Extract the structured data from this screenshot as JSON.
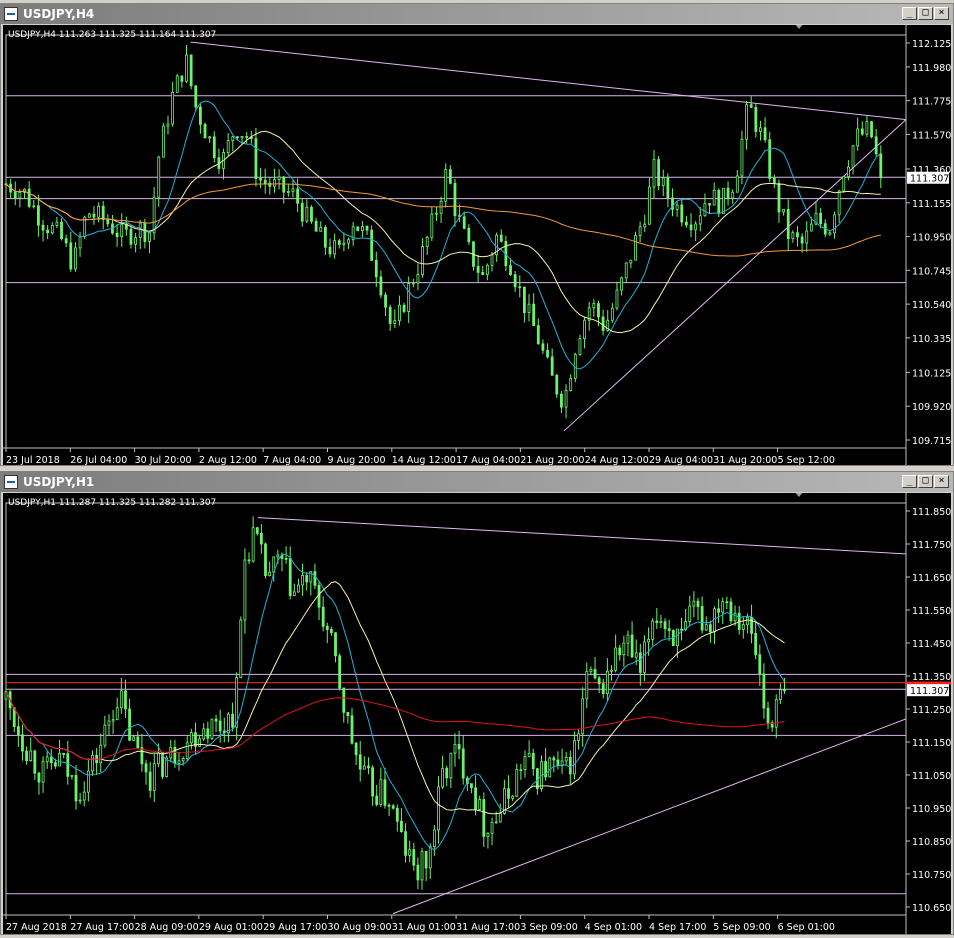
{
  "windows": [
    {
      "title": "USDJPY,H4",
      "info": "USDJPY,H4  111.263 111.325 111.164 111.307",
      "current_price": "111.307",
      "chart_data": {
        "type": "candlestick",
        "symbol": "USDJPY",
        "timeframe": "H4",
        "ylim": [
          109.715,
          112.125
        ],
        "y_ticks": [
          "112.125",
          "111.980",
          "111.775",
          "111.570",
          "111.360",
          "111.155",
          "110.950",
          "110.745",
          "110.540",
          "110.335",
          "110.125",
          "109.920",
          "109.715"
        ],
        "x_ticks": [
          "23 Jul 2018",
          "26 Jul 04:00",
          "30 Jul 20:00",
          "2 Aug 12:00",
          "7 Aug 04:00",
          "9 Aug 20:00",
          "14 Aug 12:00",
          "17 Aug 04:00",
          "21 Aug 20:00",
          "24 Aug 12:00",
          "29 Aug 04:00",
          "31 Aug 20:00",
          "5 Sep 12:00"
        ],
        "last_price": 111.307,
        "horizontal_lines": [
          111.805,
          111.31,
          111.18,
          110.67
        ],
        "trendlines": [
          {
            "from": [
              0.205,
              112.13
            ],
            "to": [
              1.0,
              111.66
            ]
          },
          {
            "from": [
              0.62,
              109.77
            ],
            "to": [
              1.0,
              111.66
            ]
          }
        ],
        "price_path": [
          [
            0.0,
            111.27
          ],
          [
            0.02,
            111.22
          ],
          [
            0.04,
            111.05
          ],
          [
            0.06,
            110.95
          ],
          [
            0.075,
            110.78
          ],
          [
            0.09,
            111.1
          ],
          [
            0.11,
            111.05
          ],
          [
            0.13,
            110.95
          ],
          [
            0.15,
            111.0
          ],
          [
            0.16,
            110.98
          ],
          [
            0.17,
            111.45
          ],
          [
            0.185,
            111.8
          ],
          [
            0.2,
            112.02
          ],
          [
            0.21,
            111.75
          ],
          [
            0.225,
            111.55
          ],
          [
            0.24,
            111.4
          ],
          [
            0.255,
            111.62
          ],
          [
            0.27,
            111.55
          ],
          [
            0.28,
            111.3
          ],
          [
            0.3,
            111.25
          ],
          [
            0.32,
            111.2
          ],
          [
            0.335,
            111.05
          ],
          [
            0.355,
            110.9
          ],
          [
            0.37,
            110.85
          ],
          [
            0.385,
            111.05
          ],
          [
            0.4,
            110.95
          ],
          [
            0.415,
            110.7
          ],
          [
            0.43,
            110.35
          ],
          [
            0.445,
            110.6
          ],
          [
            0.46,
            110.8
          ],
          [
            0.475,
            111.05
          ],
          [
            0.49,
            111.35
          ],
          [
            0.5,
            111.1
          ],
          [
            0.515,
            110.85
          ],
          [
            0.53,
            110.7
          ],
          [
            0.545,
            110.95
          ],
          [
            0.56,
            110.8
          ],
          [
            0.575,
            110.55
          ],
          [
            0.59,
            110.35
          ],
          [
            0.605,
            110.1
          ],
          [
            0.62,
            109.95
          ],
          [
            0.635,
            110.35
          ],
          [
            0.65,
            110.55
          ],
          [
            0.665,
            110.4
          ],
          [
            0.68,
            110.6
          ],
          [
            0.695,
            110.85
          ],
          [
            0.71,
            111.1
          ],
          [
            0.72,
            111.35
          ],
          [
            0.735,
            111.2
          ],
          [
            0.75,
            111.1
          ],
          [
            0.765,
            111.05
          ],
          [
            0.78,
            111.2
          ],
          [
            0.795,
            111.15
          ],
          [
            0.81,
            111.3
          ],
          [
            0.825,
            111.75
          ],
          [
            0.84,
            111.55
          ],
          [
            0.855,
            111.2
          ],
          [
            0.87,
            110.95
          ],
          [
            0.885,
            110.9
          ],
          [
            0.9,
            111.05
          ],
          [
            0.915,
            111.0
          ],
          [
            0.93,
            111.35
          ],
          [
            0.945,
            111.55
          ],
          [
            0.96,
            111.6
          ],
          [
            0.972,
            111.307
          ]
        ],
        "moving_averages": [
          {
            "name": "MA-fast",
            "color": "#1fb2d8",
            "period": 10
          },
          {
            "name": "MA-mid",
            "color": "#f5f0b0",
            "period": 24
          },
          {
            "name": "MA-slow",
            "color": "#f29a3a",
            "period": 100
          }
        ]
      }
    },
    {
      "title": "USDJPY,H1",
      "info": "USDJPY,H1  111.287 111.325 111.282 111.307",
      "current_price": "111.307",
      "chart_data": {
        "type": "candlestick",
        "symbol": "USDJPY",
        "timeframe": "H1",
        "ylim": [
          110.65,
          111.85
        ],
        "y_ticks": [
          "111.850",
          "111.750",
          "111.650",
          "111.550",
          "111.450",
          "111.350",
          "111.250",
          "111.150",
          "111.050",
          "110.950",
          "110.850",
          "110.750",
          "110.650"
        ],
        "x_ticks": [
          "27 Aug 2018",
          "27 Aug 17:00",
          "28 Aug 09:00",
          "29 Aug 01:00",
          "29 Aug 17:00",
          "30 Aug 09:00",
          "31 Aug 01:00",
          "31 Aug 17:00",
          "3 Sep 09:00",
          "4 Sep 01:00",
          "4 Sep 17:00",
          "5 Sep 09:00",
          "6 Sep 01:00"
        ],
        "last_price": 111.307,
        "horizontal_lines": [
          111.355,
          111.31,
          111.17,
          110.69
        ],
        "red_level": 111.33,
        "trendlines": [
          {
            "from": [
              0.28,
              111.83
            ],
            "to": [
              1.0,
              111.72
            ]
          },
          {
            "from": [
              0.43,
              110.63
            ],
            "to": [
              1.0,
              111.22
            ]
          }
        ],
        "price_path": [
          [
            0.0,
            111.28
          ],
          [
            0.02,
            111.15
          ],
          [
            0.04,
            111.05
          ],
          [
            0.06,
            111.1
          ],
          [
            0.08,
            111.0
          ],
          [
            0.1,
            111.1
          ],
          [
            0.115,
            111.22
          ],
          [
            0.125,
            111.3
          ],
          [
            0.14,
            111.15
          ],
          [
            0.16,
            111.05
          ],
          [
            0.18,
            111.1
          ],
          [
            0.2,
            111.15
          ],
          [
            0.22,
            111.2
          ],
          [
            0.24,
            111.2
          ],
          [
            0.255,
            111.25
          ],
          [
            0.265,
            111.7
          ],
          [
            0.275,
            111.78
          ],
          [
            0.29,
            111.65
          ],
          [
            0.305,
            111.7
          ],
          [
            0.32,
            111.6
          ],
          [
            0.335,
            111.65
          ],
          [
            0.35,
            111.55
          ],
          [
            0.365,
            111.4
          ],
          [
            0.38,
            111.2
          ],
          [
            0.395,
            111.05
          ],
          [
            0.41,
            111.0
          ],
          [
            0.425,
            110.98
          ],
          [
            0.44,
            110.85
          ],
          [
            0.455,
            110.75
          ],
          [
            0.47,
            110.8
          ],
          [
            0.485,
            111.05
          ],
          [
            0.5,
            111.12
          ],
          [
            0.515,
            111.05
          ],
          [
            0.53,
            110.9
          ],
          [
            0.545,
            110.92
          ],
          [
            0.56,
            111.0
          ],
          [
            0.575,
            111.1
          ],
          [
            0.59,
            111.05
          ],
          [
            0.605,
            111.08
          ],
          [
            0.62,
            111.05
          ],
          [
            0.635,
            111.15
          ],
          [
            0.645,
            111.35
          ],
          [
            0.66,
            111.3
          ],
          [
            0.675,
            111.4
          ],
          [
            0.69,
            111.45
          ],
          [
            0.705,
            111.35
          ],
          [
            0.72,
            111.55
          ],
          [
            0.735,
            111.5
          ],
          [
            0.75,
            111.45
          ],
          [
            0.765,
            111.55
          ],
          [
            0.78,
            111.5
          ],
          [
            0.795,
            111.6
          ],
          [
            0.81,
            111.55
          ],
          [
            0.825,
            111.5
          ],
          [
            0.835,
            111.4
          ],
          [
            0.845,
            111.2
          ],
          [
            0.855,
            111.25
          ],
          [
            0.865,
            111.307
          ]
        ],
        "moving_averages": [
          {
            "name": "MA-fast",
            "color": "#1fb2d8",
            "period": 10
          },
          {
            "name": "MA-mid",
            "color": "#f5f0b0",
            "period": 24
          },
          {
            "name": "MA-slow",
            "color": "#e0141e",
            "period": 100
          }
        ]
      }
    }
  ]
}
